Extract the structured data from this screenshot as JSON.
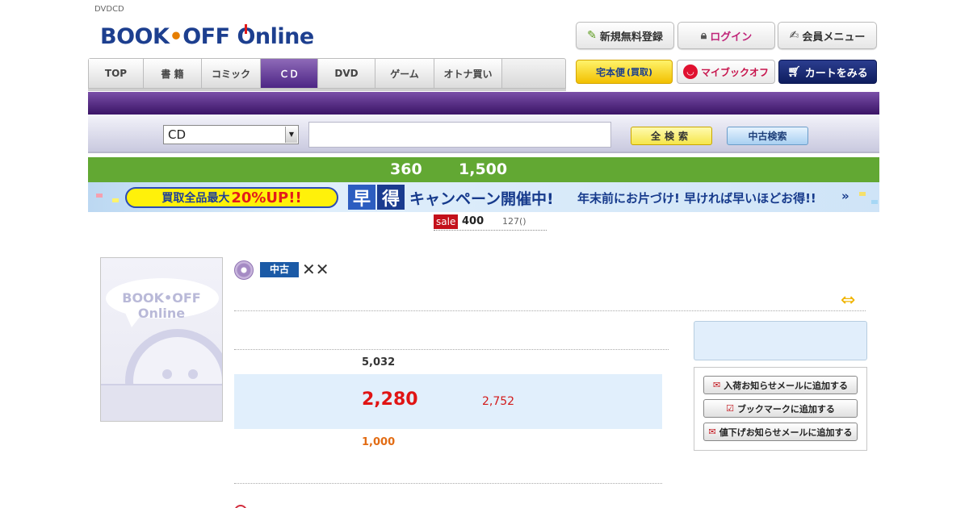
{
  "header": {
    "tagline": "DVDCD",
    "logo": {
      "part1": "BOOK",
      "dot": "•",
      "part2": "OFF",
      "part3": "nline",
      "o": "O"
    },
    "buttons": {
      "register": {
        "label": "新規無料登録",
        "icon": "pencil-icon"
      },
      "login": {
        "label": "ログイン",
        "icon": "lock-icon"
      },
      "member": {
        "label": "会員メニュー",
        "icon": "notepad-icon"
      }
    },
    "row2": {
      "takuhai": {
        "label": "宅本便",
        "sub": "(買取)"
      },
      "mybook": {
        "label": "マイブックオフ",
        "icon": "smile-icon"
      },
      "cart": {
        "label": "カートをみる",
        "icon": "cart-icon"
      }
    }
  },
  "nav": {
    "tabs": [
      {
        "label": "TOP",
        "active": false
      },
      {
        "label": "書 籍",
        "active": false
      },
      {
        "label": "コミック",
        "active": false
      },
      {
        "label": "ＣＤ",
        "active": true
      },
      {
        "label": "DVD",
        "active": false
      },
      {
        "label": "ゲーム",
        "active": false
      },
      {
        "label": "オトナ買い",
        "active": false
      }
    ]
  },
  "search": {
    "category_selected": "CD",
    "query_value": "",
    "all_search_label": "全検索",
    "used_search_label": "中古検索"
  },
  "promo_bar": {
    "value1": "360",
    "value2": "1,500"
  },
  "campaign": {
    "pill_text": "買取全品最大",
    "pill_highlight": "20%UP!!",
    "box1": "早",
    "box2": "得",
    "headline": "キャンペーン開催中!",
    "subline": "年末前にお片づけ! 早ければ早いほどお得!!",
    "arrow": "»"
  },
  "sale": {
    "badge": "sale",
    "number": "400",
    "count": "127()"
  },
  "product": {
    "image_logo": "BOOK•OFF Online",
    "used_badge": "中古",
    "title": "✕✕",
    "list_price": "5,032",
    "price": "2,280",
    "savings": "2,752",
    "points": "1,000"
  },
  "actions": {
    "stock_mail": "入荷お知らせメールに追加する",
    "bookmark": "ブックマークに追加する",
    "price_down_mail": "値下げお知らせメールに追加する"
  },
  "colors": {
    "brand_blue": "#1d3f8f",
    "nav_active": "#4d2585",
    "promo_green": "#62a833",
    "price_red": "#e01414",
    "points_orange": "#e26c14"
  }
}
